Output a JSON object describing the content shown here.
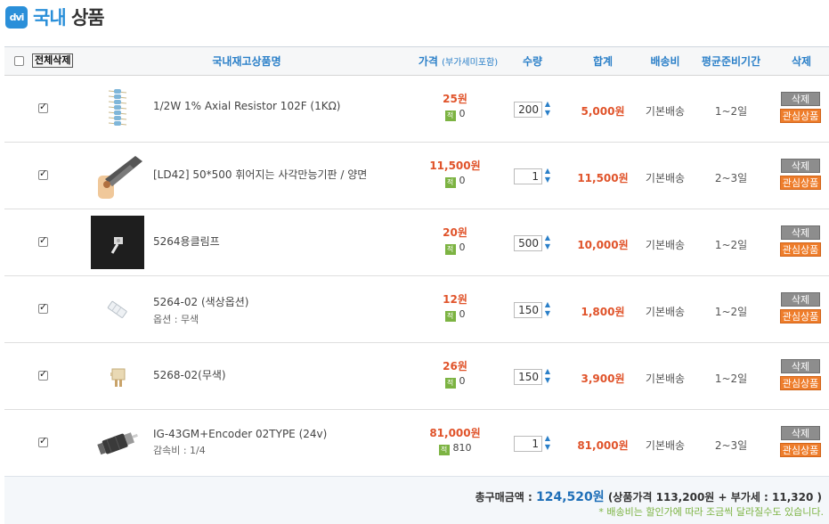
{
  "header": {
    "logo": "dvi",
    "title_accent": "국내",
    "title": "상품"
  },
  "columns": {
    "delete_all": "전체삭제",
    "name": "국내재고상품명",
    "price": "가격",
    "price_note": "(부가세미포함)",
    "qty": "수량",
    "total": "합계",
    "shipping": "배송비",
    "lead": "평균준비기간",
    "delete": "삭제"
  },
  "rows": [
    {
      "name": "1/2W 1% Axial Resistor 102F (1KΩ)",
      "option": "",
      "price": "25원",
      "points_icon": "적",
      "points": "0",
      "qty": "200",
      "total": "5,000원",
      "shipping": "기본배송",
      "lead": "1~2일",
      "del": "삭제",
      "wish": "관심상품",
      "checked": true,
      "thumb": "resistor"
    },
    {
      "name": "[LD42] 50*500 휘어지는 사각만능기판 / 양면",
      "option": "",
      "price": "11,500원",
      "points_icon": "적",
      "points": "0",
      "qty": "1",
      "total": "11,500원",
      "shipping": "기본배송",
      "lead": "2~3일",
      "del": "삭제",
      "wish": "관심상품",
      "checked": true,
      "thumb": "pcb"
    },
    {
      "name": "5264용클림프",
      "option": "",
      "price": "20원",
      "points_icon": "적",
      "points": "0",
      "qty": "500",
      "total": "10,000원",
      "shipping": "기본배송",
      "lead": "1~2일",
      "del": "삭제",
      "wish": "관심상품",
      "checked": true,
      "thumb": "crimp"
    },
    {
      "name": "5264-02 (색상옵션)",
      "option": "옵션 : 무색",
      "price": "12원",
      "points_icon": "적",
      "points": "0",
      "qty": "150",
      "total": "1,800원",
      "shipping": "기본배송",
      "lead": "1~2일",
      "del": "삭제",
      "wish": "관심상품",
      "checked": true,
      "thumb": "housing-clear"
    },
    {
      "name": "5268-02(무색)",
      "option": "",
      "price": "26원",
      "points_icon": "적",
      "points": "0",
      "qty": "150",
      "total": "3,900원",
      "shipping": "기본배송",
      "lead": "1~2일",
      "del": "삭제",
      "wish": "관심상품",
      "checked": true,
      "thumb": "housing-beige"
    },
    {
      "name": "IG-43GM+Encoder 02TYPE (24v)",
      "option": "감속비 : 1/4",
      "price": "81,000원",
      "points_icon": "적",
      "points": "810",
      "qty": "1",
      "total": "81,000원",
      "shipping": "기본배송",
      "lead": "2~3일",
      "del": "삭제",
      "wish": "관심상품",
      "checked": true,
      "thumb": "motor"
    }
  ],
  "summary": {
    "label": "총구매금액 :",
    "amount": "124,520원",
    "detail": "(상품가격 113,200원 + 부가세 : 11,320 )",
    "note": "* 배송비는 할인가에 따라 조금씩 달라질수도 있습니다."
  },
  "colors": {
    "accent": "#2a8fd9",
    "price": "#e0532a",
    "wish": "#ee7d2b",
    "points": "#7cb342"
  }
}
